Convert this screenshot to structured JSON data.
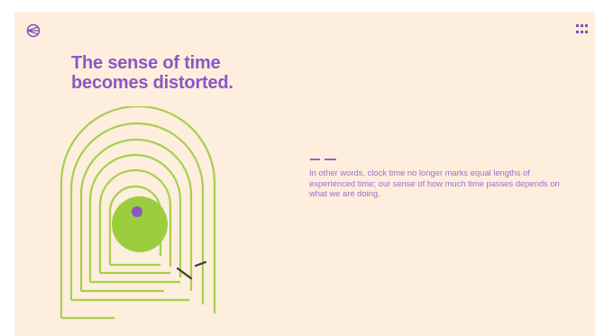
{
  "brand": {
    "logo_icon": "brand-logo-icon"
  },
  "menu": {
    "icon": "grid-menu-icon"
  },
  "headline": {
    "line1": "The sense of time",
    "line2": "becomes distorted."
  },
  "body": {
    "text": "In other words, clock time no longer marks equal lengths of experienced time; our sense of how much time passes depends on what we are doing."
  },
  "colors": {
    "background": "#fdeedd",
    "accent_purple": "#8a58c4",
    "line_green": "#a8cf4f",
    "circle_green": "#9ccd3c",
    "ink": "#3a3a3a"
  }
}
